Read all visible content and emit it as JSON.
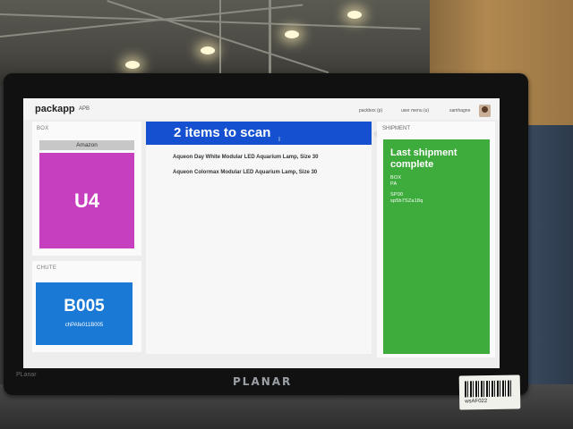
{
  "app": {
    "brand": "packapp",
    "brand_sub": "APB",
    "nav_links": [
      "packbox (p)",
      "user menu (u)"
    ],
    "username": "samhagne"
  },
  "box": {
    "header": "BOX",
    "carrier": "Amazon",
    "code": "U4"
  },
  "chute": {
    "header": "CHUTE",
    "code": "B005",
    "id": "chPAfe011B005"
  },
  "items": {
    "title": "2 items to scan",
    "list": [
      "Aqueon Day White Modular LED Aquarium Lamp, Size 30",
      "Aqueon Colormax Modular LED Aquarium Lamp, Size 30"
    ]
  },
  "shipment": {
    "header": "SHIPMENT",
    "status": "Last shipment complete",
    "lines": [
      "BOX",
      "PA",
      "SP00",
      "sp5b7SZa18q"
    ]
  },
  "bezel": {
    "brand": "PLANAR",
    "small": "PLanar"
  },
  "sticker": {
    "text": "wsAF022"
  },
  "colors": {
    "box_tile": "#c53fbe",
    "chute_tile": "#1a79d4",
    "items_header": "#1450cf",
    "shipment_tile": "#3eab3d"
  },
  "icons": [
    "cursor-icon",
    "barcode-icon",
    "avatar-icon",
    "arrow-left-icon"
  ]
}
